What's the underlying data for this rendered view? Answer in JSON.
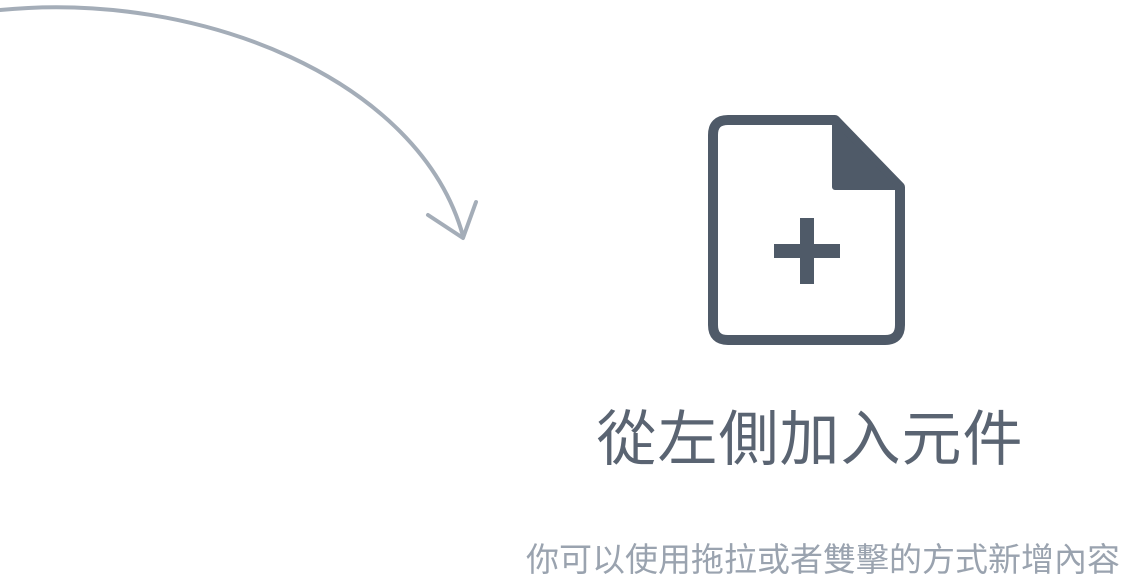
{
  "empty_state": {
    "title": "從左側加入元件",
    "subtitle": "你可以使用拖拉或者雙擊的方式新增內容"
  },
  "icons": {
    "arrow": "curved-arrow-icon",
    "document": "document-add-icon"
  },
  "colors": {
    "arrow": "#a4adb8",
    "icon": "#4f5a68",
    "title": "#5a6472",
    "subtitle": "#9aa3af"
  }
}
